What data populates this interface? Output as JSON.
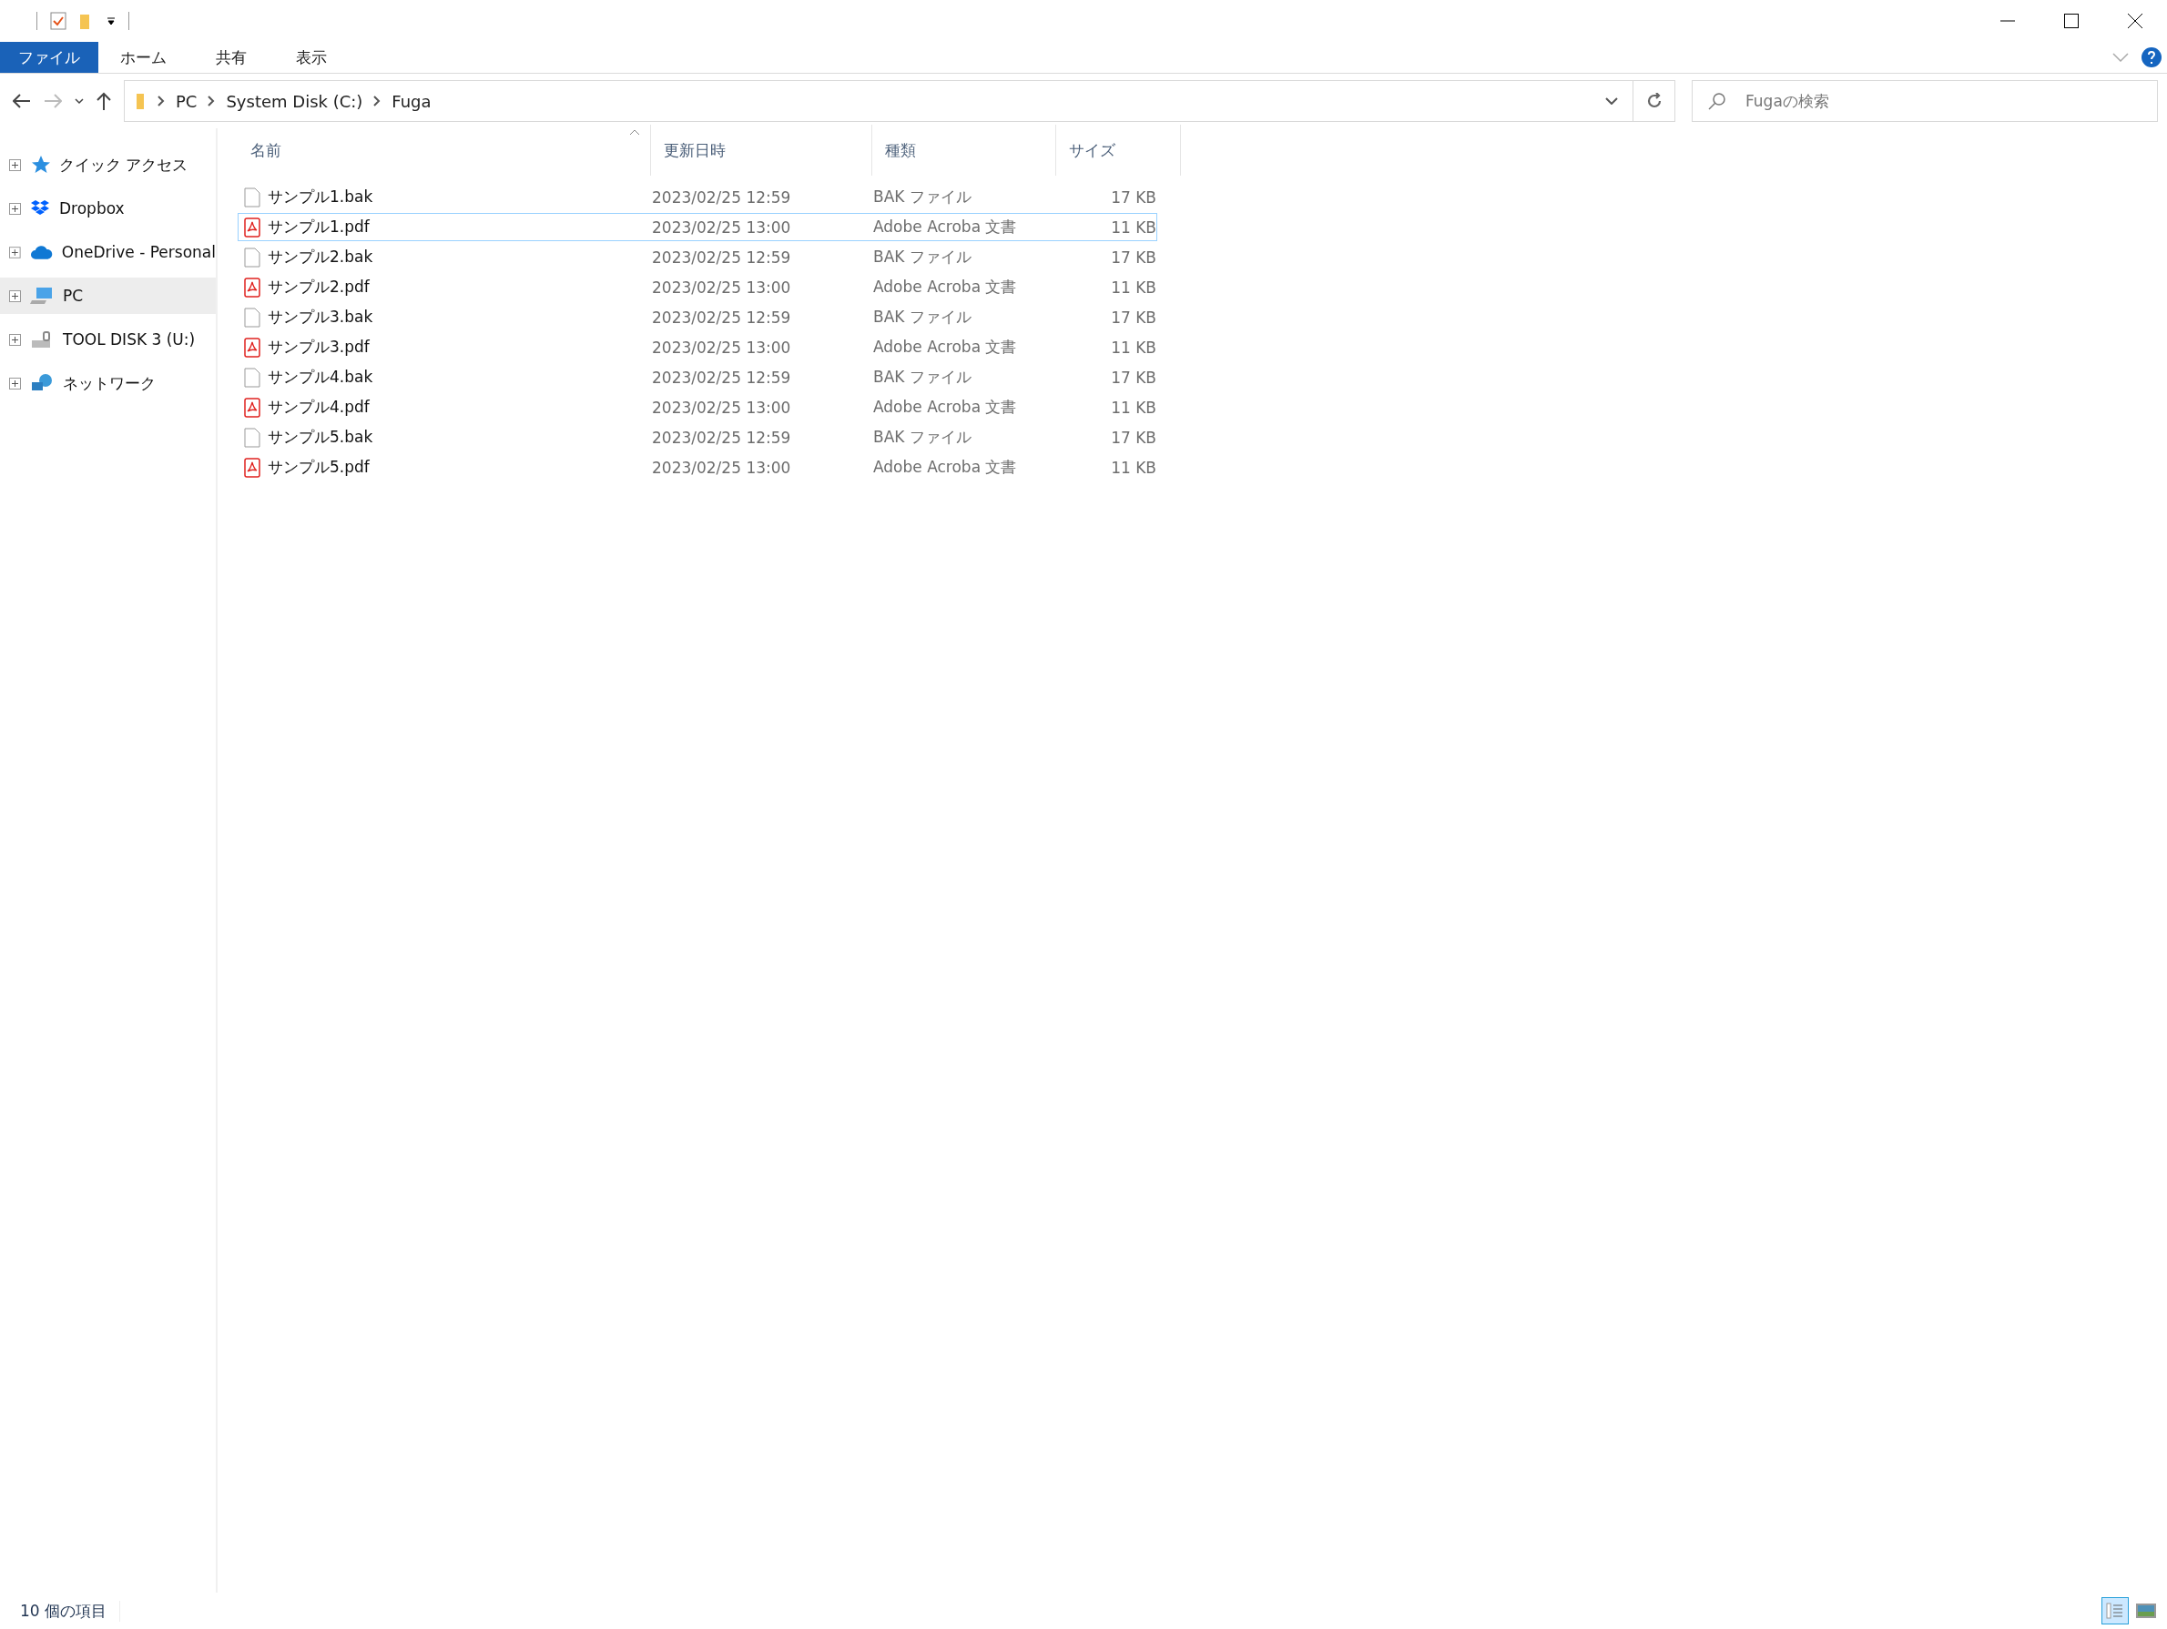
{
  "ribbon_tabs": [
    {
      "label": "ファイル",
      "selected": true
    },
    {
      "label": "ホーム",
      "selected": false
    },
    {
      "label": "共有",
      "selected": false
    },
    {
      "label": "表示",
      "selected": false
    }
  ],
  "breadcrumb": [
    "PC",
    "System Disk (C:)",
    "Fuga"
  ],
  "search": {
    "placeholder": "Fugaの検索"
  },
  "sidebar": {
    "items": [
      {
        "label": "クイック アクセス",
        "kind": "star",
        "selected": false
      },
      {
        "label": "Dropbox",
        "kind": "dropbox",
        "selected": false
      },
      {
        "label": "OneDrive - Personal",
        "kind": "cloud",
        "selected": false
      },
      {
        "label": "PC",
        "kind": "pc",
        "selected": true
      },
      {
        "label": "TOOL DISK 3 (U:)",
        "kind": "drive",
        "selected": false
      },
      {
        "label": "ネットワーク",
        "kind": "network",
        "selected": false
      }
    ]
  },
  "table": {
    "columns": [
      "名前",
      "更新日時",
      "種類",
      "サイズ"
    ],
    "rows": [
      {
        "name": "サンプル1.bak",
        "kind": "bak",
        "date": "2023/02/25 12:59",
        "type": "BAK ファイル",
        "size": "17 KB",
        "selected": false
      },
      {
        "name": "サンプル1.pdf",
        "kind": "pdf",
        "date": "2023/02/25 13:00",
        "type": "Adobe Acroba 文書",
        "size": "11 KB",
        "selected": true
      },
      {
        "name": "サンプル2.bak",
        "kind": "bak",
        "date": "2023/02/25 12:59",
        "type": "BAK ファイル",
        "size": "17 KB",
        "selected": false
      },
      {
        "name": "サンプル2.pdf",
        "kind": "pdf",
        "date": "2023/02/25 13:00",
        "type": "Adobe Acroba 文書",
        "size": "11 KB",
        "selected": false
      },
      {
        "name": "サンプル3.bak",
        "kind": "bak",
        "date": "2023/02/25 12:59",
        "type": "BAK ファイル",
        "size": "17 KB",
        "selected": false
      },
      {
        "name": "サンプル3.pdf",
        "kind": "pdf",
        "date": "2023/02/25 13:00",
        "type": "Adobe Acroba 文書",
        "size": "11 KB",
        "selected": false
      },
      {
        "name": "サンプル4.bak",
        "kind": "bak",
        "date": "2023/02/25 12:59",
        "type": "BAK ファイル",
        "size": "17 KB",
        "selected": false
      },
      {
        "name": "サンプル4.pdf",
        "kind": "pdf",
        "date": "2023/02/25 13:00",
        "type": "Adobe Acroba 文書",
        "size": "11 KB",
        "selected": false
      },
      {
        "name": "サンプル5.bak",
        "kind": "bak",
        "date": "2023/02/25 12:59",
        "type": "BAK ファイル",
        "size": "17 KB",
        "selected": false
      },
      {
        "name": "サンプル5.pdf",
        "kind": "pdf",
        "date": "2023/02/25 13:00",
        "type": "Adobe Acroba 文書",
        "size": "11 KB",
        "selected": false
      }
    ]
  },
  "status_bar": {
    "item_count": "10 個の項目"
  },
  "view_buttons": [
    {
      "kind": "details",
      "selected": true
    },
    {
      "kind": "large_icons",
      "selected": false
    }
  ]
}
